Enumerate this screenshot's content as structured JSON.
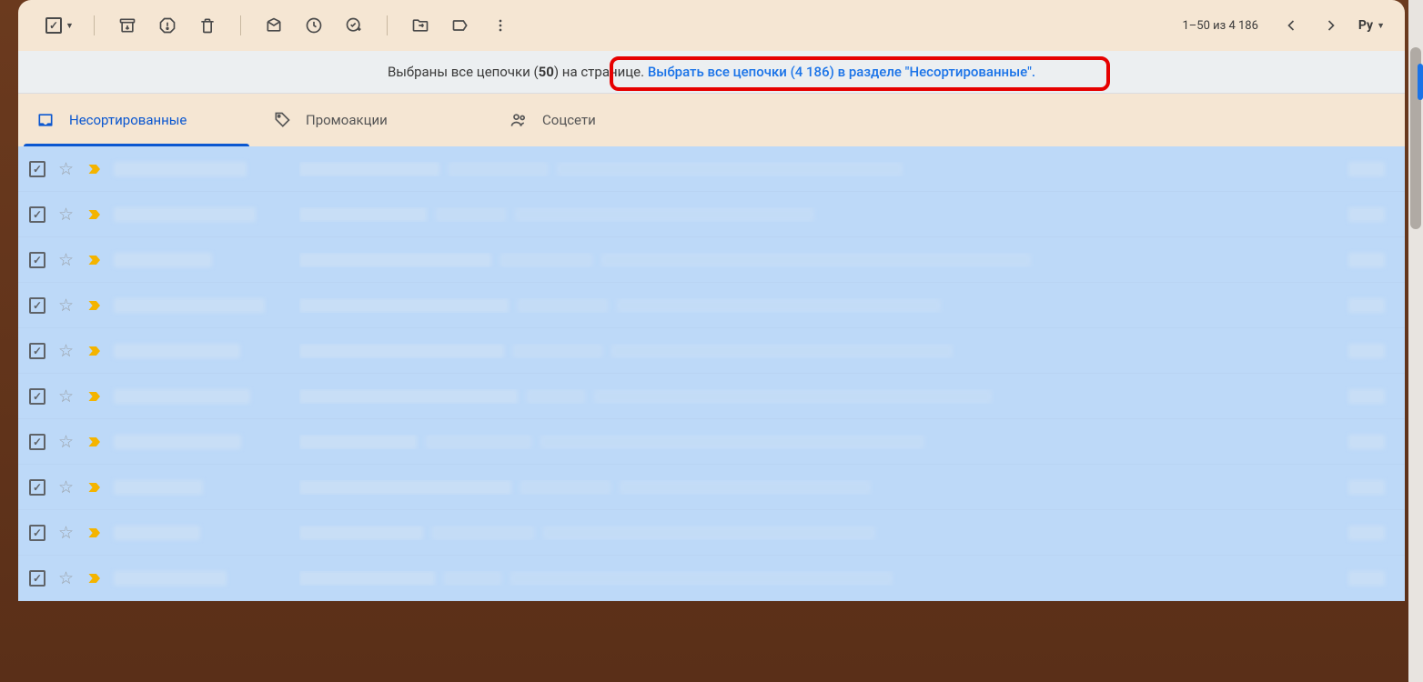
{
  "toolbar": {
    "page_info": "1–50 из 4 186",
    "input_lang": "Ру"
  },
  "banner": {
    "text_before": "Выбраны все цепочки (",
    "count_bold": "50",
    "text_after": ") на странице. ",
    "link_text": "Выбрать все цепочки (4 186) в разделе \"Несортированные\"."
  },
  "tabs": [
    {
      "label": "Несортированные",
      "active": true
    },
    {
      "label": "Промоакции",
      "active": false
    },
    {
      "label": "Соцсети",
      "active": false
    }
  ],
  "rows_count": 10
}
